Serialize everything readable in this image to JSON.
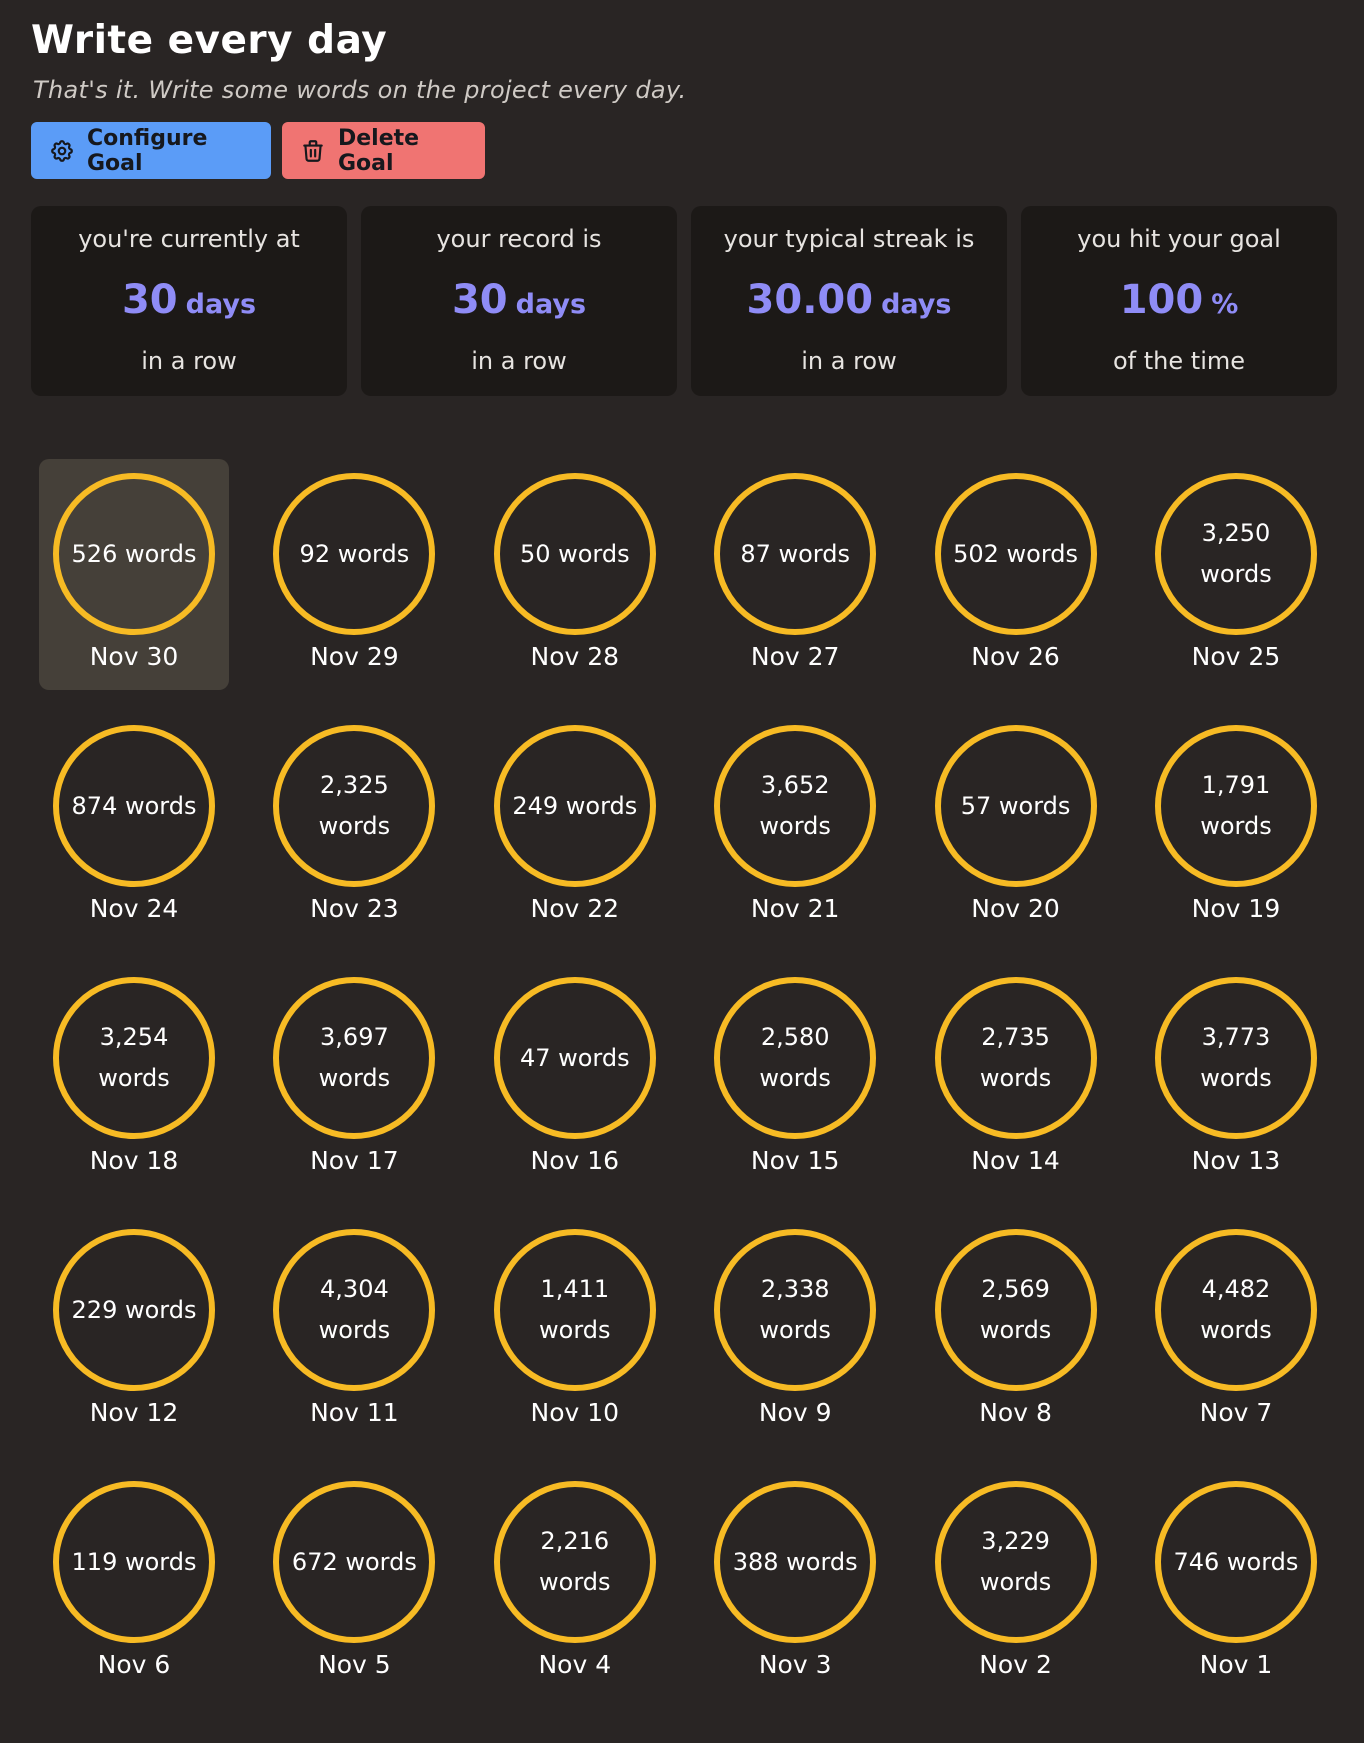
{
  "goal": {
    "title": "Write every day",
    "description": "That's it. Write some words on the project every day."
  },
  "actions": {
    "configure_label": "Configure Goal",
    "configure_icon": "gear-icon",
    "delete_label": "Delete Goal",
    "delete_icon": "trash-icon"
  },
  "colors": {
    "accent_blue": "#5b9cf7",
    "accent_red": "#f07472",
    "stat_value": "#8f8cf6",
    "ring": "#f7bb24",
    "background": "#292524",
    "card": "#1c1917"
  },
  "stats": [
    {
      "top": "you're currently at",
      "value": "30",
      "unit": "days",
      "bottom": "in a row"
    },
    {
      "top": "your record is",
      "value": "30",
      "unit": "days",
      "bottom": "in a row"
    },
    {
      "top": "your typical streak is",
      "value": "30.00",
      "unit": "days",
      "bottom": "in a row"
    },
    {
      "top": "you hit your goal",
      "value": "100",
      "unit": "%",
      "bottom": "of the time"
    }
  ],
  "days": [
    {
      "words": "526 words",
      "date": "Nov 30",
      "selected": true
    },
    {
      "words": "92 words",
      "date": "Nov 29"
    },
    {
      "words": "50 words",
      "date": "Nov 28"
    },
    {
      "words": "87 words",
      "date": "Nov 27"
    },
    {
      "words": "502 words",
      "date": "Nov 26"
    },
    {
      "words": "3,250 words",
      "date": "Nov 25"
    },
    {
      "words": "874 words",
      "date": "Nov 24"
    },
    {
      "words": "2,325 words",
      "date": "Nov 23"
    },
    {
      "words": "249 words",
      "date": "Nov 22"
    },
    {
      "words": "3,652 words",
      "date": "Nov 21"
    },
    {
      "words": "57 words",
      "date": "Nov 20"
    },
    {
      "words": "1,791 words",
      "date": "Nov 19"
    },
    {
      "words": "3,254 words",
      "date": "Nov 18"
    },
    {
      "words": "3,697 words",
      "date": "Nov 17"
    },
    {
      "words": "47 words",
      "date": "Nov 16"
    },
    {
      "words": "2,580 words",
      "date": "Nov 15"
    },
    {
      "words": "2,735 words",
      "date": "Nov 14"
    },
    {
      "words": "3,773 words",
      "date": "Nov 13"
    },
    {
      "words": "229 words",
      "date": "Nov 12"
    },
    {
      "words": "4,304 words",
      "date": "Nov 11"
    },
    {
      "words": "1,411 words",
      "date": "Nov 10"
    },
    {
      "words": "2,338 words",
      "date": "Nov 9"
    },
    {
      "words": "2,569 words",
      "date": "Nov 8"
    },
    {
      "words": "4,482 words",
      "date": "Nov 7"
    },
    {
      "words": "119 words",
      "date": "Nov 6"
    },
    {
      "words": "672 words",
      "date": "Nov 5"
    },
    {
      "words": "2,216 words",
      "date": "Nov 4"
    },
    {
      "words": "388 words",
      "date": "Nov 3"
    },
    {
      "words": "3,229 words",
      "date": "Nov 2"
    },
    {
      "words": "746 words",
      "date": "Nov 1"
    }
  ]
}
